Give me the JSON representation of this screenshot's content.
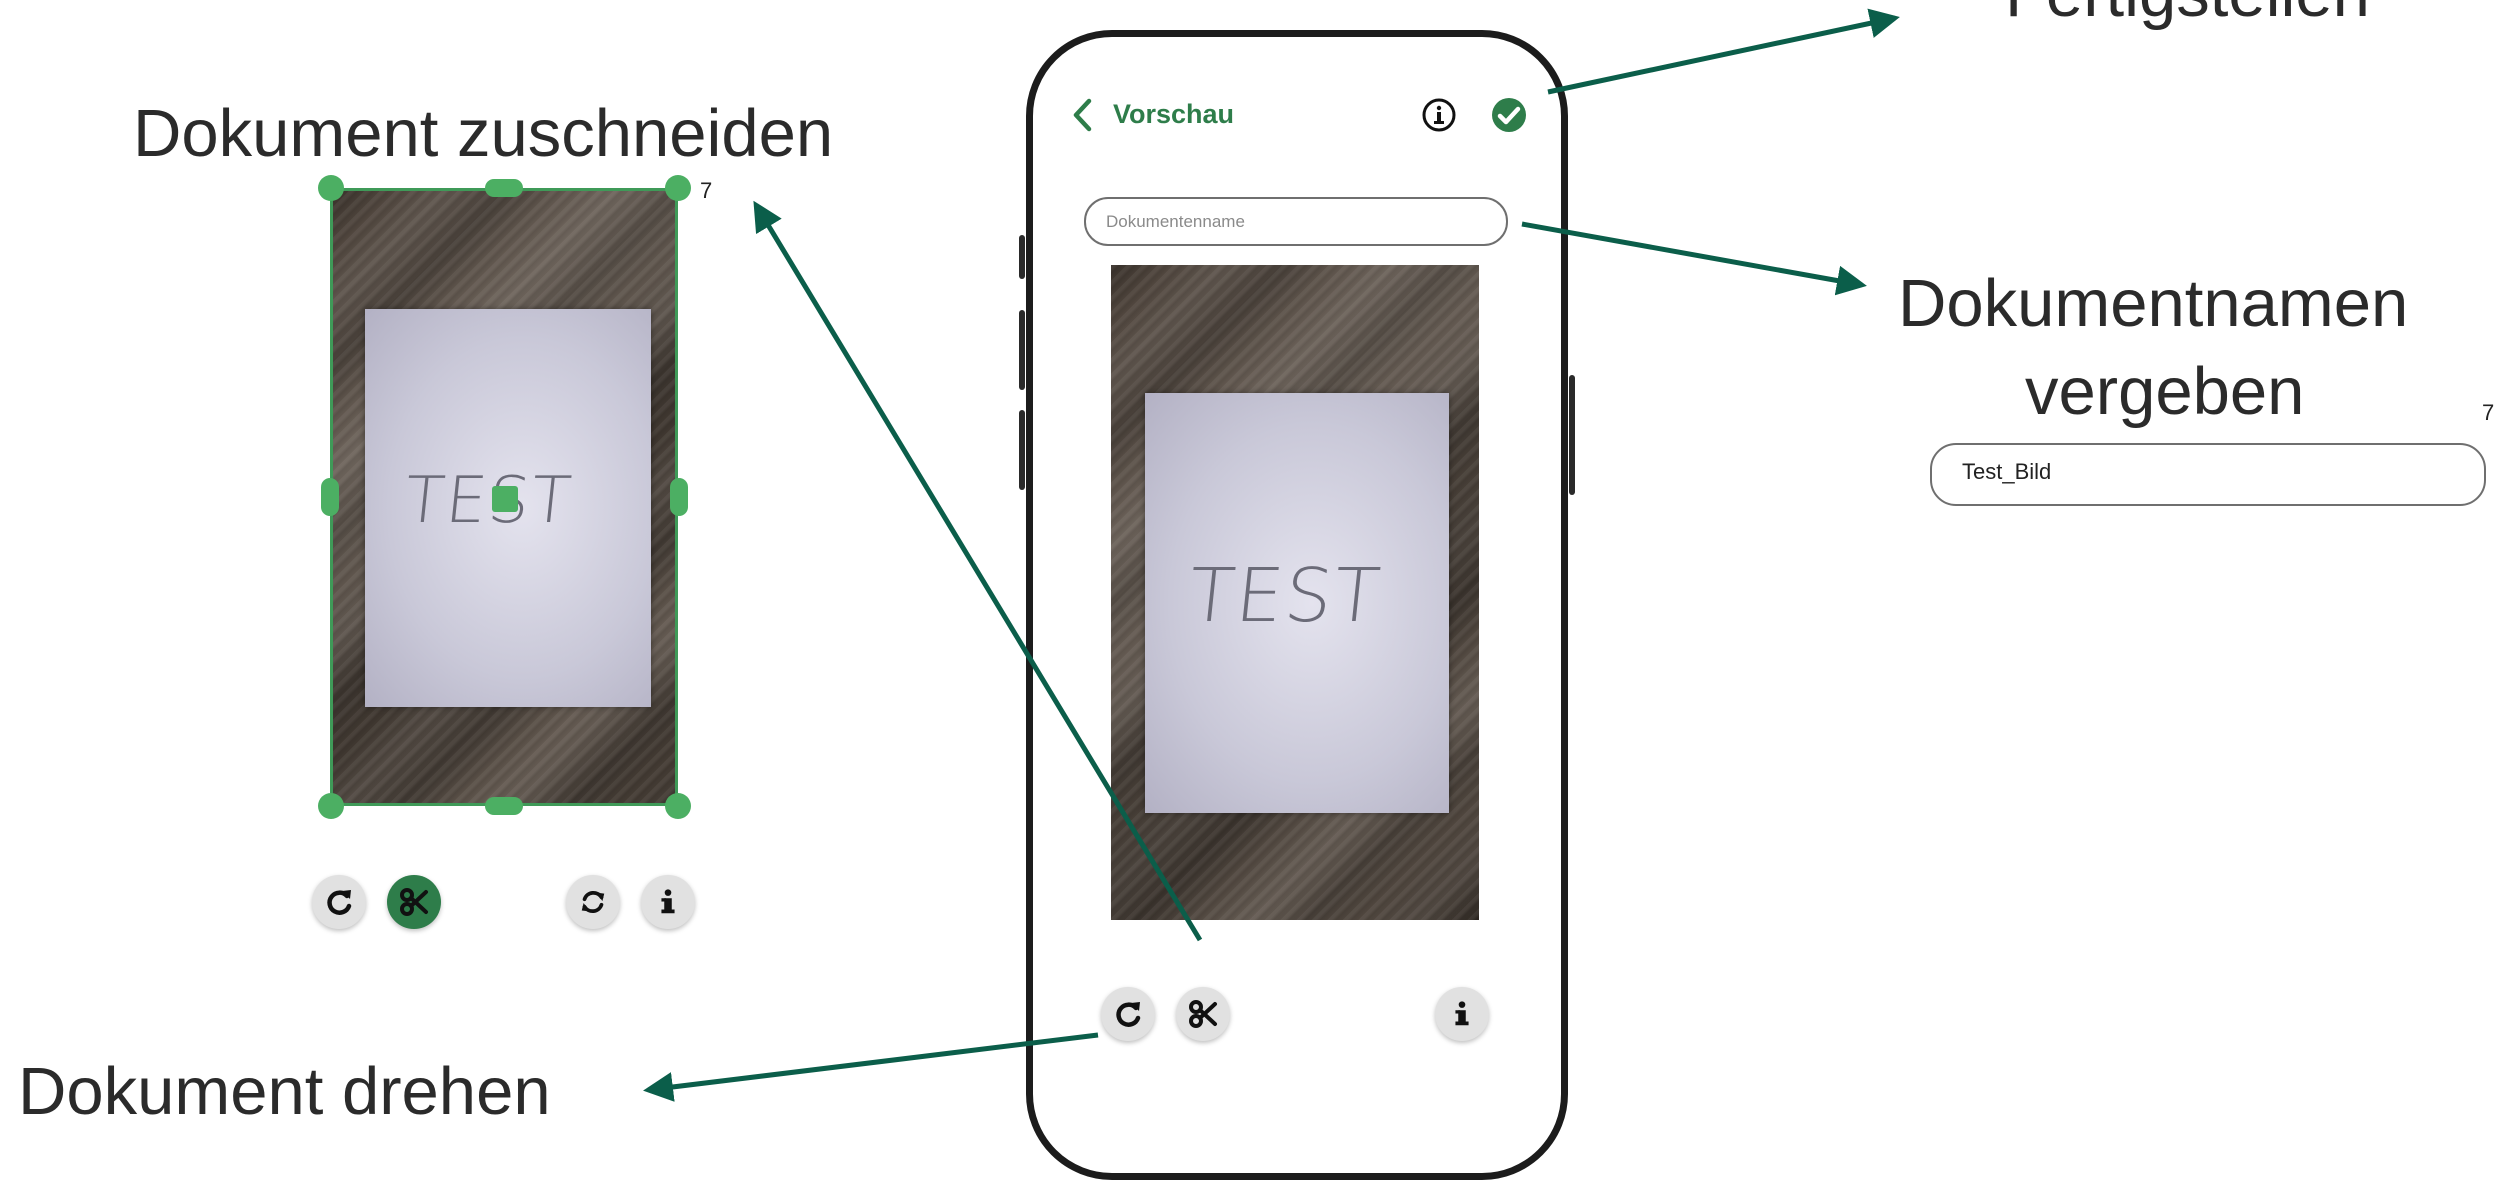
{
  "annotations": {
    "crop": "Dokument zuschneiden",
    "rotate": "Dokument drehen",
    "finish": "Fertigstellen",
    "name_line1": "Dokumentnamen",
    "name_line2": "vergeben"
  },
  "footnotes": {
    "crop": "7",
    "name": "7"
  },
  "crop_preview": {
    "handwriting": "TEST"
  },
  "phone": {
    "header_title": "Vorschau",
    "name_input_placeholder": "Dokumentenname",
    "handwriting": "TEST"
  },
  "name_example": {
    "value": "Test_Bild"
  },
  "icons": {
    "back": "chevron-left-icon",
    "info": "info-icon",
    "confirm": "check-circle-icon",
    "rotate": "rotate-icon",
    "crop": "scissors-icon",
    "reset": "refresh-icon"
  },
  "colors": {
    "accent": "#2e7d4a",
    "arrow": "#0b5e4a",
    "handle": "#4caf63"
  }
}
